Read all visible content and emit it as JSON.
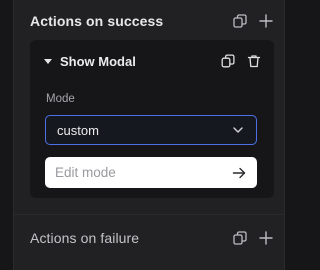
{
  "actions_success": {
    "title": "Actions on success",
    "icons": [
      "duplicate-icon",
      "plus-icon"
    ]
  },
  "action_card": {
    "title": "Show Modal",
    "icons": [
      "caret-down-icon",
      "copy-icon",
      "trash-icon"
    ],
    "mode_label": "Mode",
    "mode_value": "custom",
    "edit_placeholder": "Edit mode",
    "edit_value": ""
  },
  "actions_failure": {
    "title": "Actions on failure",
    "icons": [
      "duplicate-icon",
      "plus-icon"
    ]
  },
  "colors": {
    "background": "#161618",
    "panel": "#212123",
    "card": "#161618",
    "accent_border": "#4e6fe8",
    "input_bg": "#ffffff"
  }
}
